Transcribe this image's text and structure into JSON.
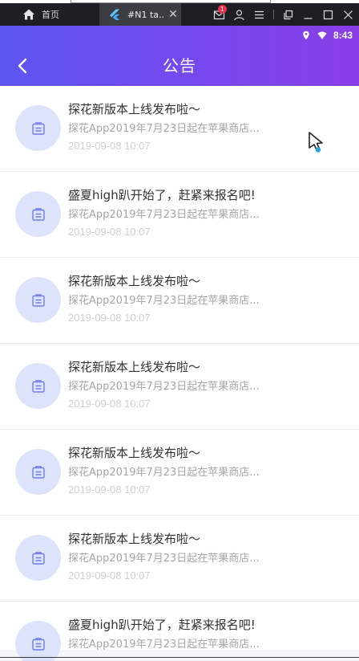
{
  "host": {
    "home_tab_label": "首页",
    "active_tab_title": "#N1 ta...",
    "tab_close_glyph": "✕",
    "notification_count": "1"
  },
  "status": {
    "time": "8:43"
  },
  "header": {
    "title": "公告"
  },
  "colors": {
    "header_gradient_start": "#5d56f3",
    "header_gradient_end": "#8a3ee9",
    "avatar_bg": "#dde3fb",
    "avatar_icon": "#6f7ef0"
  },
  "notices": [
    {
      "title": "探花新版本上线发布啦～",
      "summary": "探花App2019年7月23日起在苹果商店...",
      "date": "2019-09-08 10:07"
    },
    {
      "title": "盛夏high趴开始了，赶紧来报名吧!",
      "summary": "探花App2019年7月23日起在苹果商店...",
      "date": "2019-09-08 10:07"
    },
    {
      "title": "探花新版本上线发布啦～",
      "summary": "探花App2019年7月23日起在苹果商店...",
      "date": "2019-09-08 10:07"
    },
    {
      "title": "探花新版本上线发布啦～",
      "summary": "探花App2019年7月23日起在苹果商店...",
      "date": "2019-09-08 10:07"
    },
    {
      "title": "探花新版本上线发布啦～",
      "summary": "探花App2019年7月23日起在苹果商店...",
      "date": "2019-09-08 10:07"
    },
    {
      "title": "探花新版本上线发布啦～",
      "summary": "探花App2019年7月23日起在苹果商店...",
      "date": "2019-09-08 10:07"
    },
    {
      "title": "盛夏high趴开始了，赶紧来报名吧!",
      "summary": "探花App2019年7月23日起在苹果商店..."
    }
  ]
}
